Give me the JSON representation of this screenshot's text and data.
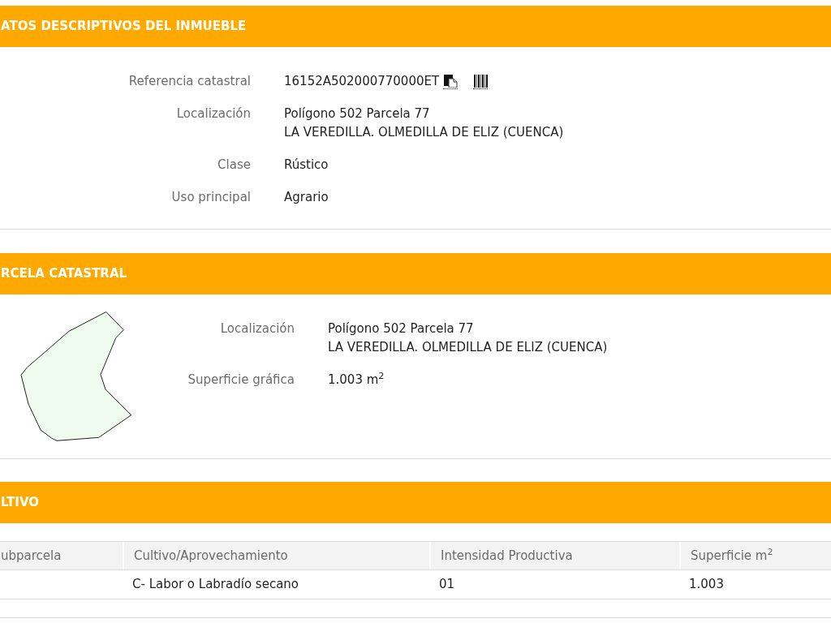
{
  "property_data": {
    "title": "ATOS DESCRIPTIVOS DEL INMUEBLE",
    "fields": [
      {
        "kind": "reference",
        "label": "Referencia catastral",
        "value_lines": [
          "16152A502000770000ET"
        ]
      },
      {
        "kind": "text",
        "label": "Localización",
        "value_lines": [
          "Polígono 502 Parcela 77",
          "LA VEREDILLA. OLMEDILLA DE ELIZ (CUENCA)"
        ]
      },
      {
        "kind": "text",
        "label": "Clase",
        "value_lines": [
          "Rústico"
        ]
      },
      {
        "kind": "text",
        "label": "Uso principal",
        "value_lines": [
          "Agrario"
        ]
      }
    ]
  },
  "parcel": {
    "title": "RCELA CATASTRAL",
    "fields": [
      {
        "kind": "text",
        "label": "Localización",
        "value_lines": [
          "Polígono 502 Parcela 77",
          "LA VEREDILLA. OLMEDILLA DE ELIZ (CUENCA)"
        ]
      },
      {
        "kind": "text",
        "label": "Superficie gráfica",
        "value_lines": [
          "1.003 m$^{2}$"
        ]
      }
    ]
  },
  "crops": {
    "title": "LTIVO",
    "table": {
      "columns": [
        "ubparcela",
        "Cultivo/Aprovechamiento",
        "Intensidad Productiva",
        "Superficie m$^{2}$"
      ],
      "rows": [
        {
          "column_2": "C- Labor o Labradío secano",
          "column_3": "01",
          "column_4": "1.003"
        }
      ]
    }
  }
}
